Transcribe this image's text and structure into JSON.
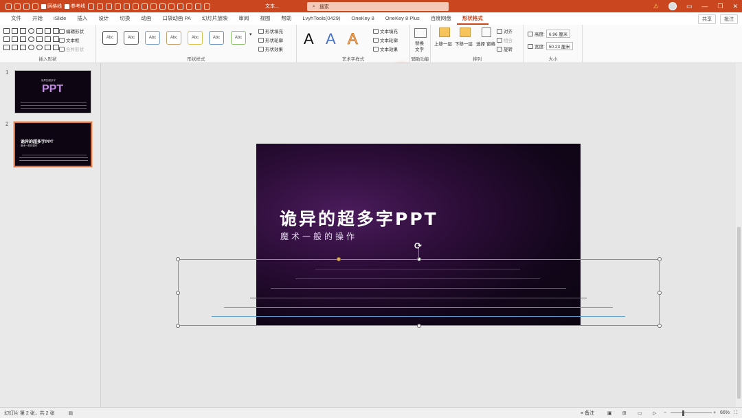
{
  "titlebar": {
    "gridlines_label": "网格线",
    "guides_label": "参考线",
    "doc_title": "文本...",
    "search_placeholder": "搜索",
    "warning_icon": "warning-icon"
  },
  "tabs": [
    "文件",
    "开始",
    "iSlide",
    "插入",
    "设计",
    "切换",
    "动画",
    "口袋动画 PA",
    "幻灯片放映",
    "审阅",
    "视图",
    "帮助",
    "LvyhTools(0429)",
    "OneKey 8",
    "OneKey 8 Plus",
    "百度网盘",
    "形状格式"
  ],
  "active_tab": "形状格式",
  "share_label": "共享",
  "comments_label": "批注",
  "ribbon": {
    "insert_shapes": {
      "label": "插入形状",
      "edit_shape": "编辑形状",
      "text_box": "文本框",
      "merge_shapes": "合并形状"
    },
    "shape_styles": {
      "label": "形状样式",
      "preset_text": "Abc",
      "fill": "形状填充",
      "outline": "形状轮廓",
      "effects": "形状效果"
    },
    "wordart_styles": {
      "label": "艺术字样式",
      "glyph": "A",
      "text_fill": "文本填充",
      "text_outline": "文本轮廓",
      "text_effects": "文本效果"
    },
    "accessibility": {
      "label": "辅助功能",
      "alt_text_line1": "替换",
      "alt_text_line2": "文字"
    },
    "arrange": {
      "label": "排列",
      "bring_forward": "上移一层",
      "send_backward": "下移一层",
      "selection_pane_line1": "选择",
      "selection_pane_line2": "窗格",
      "align": "对齐",
      "group": "组合",
      "rotate": "旋转"
    },
    "size": {
      "label": "大小",
      "height_label": "高度:",
      "height_value": "6.96 厘米",
      "width_label": "宽度:",
      "width_value": "50.23 厘米"
    }
  },
  "slides": [
    {
      "number": "1",
      "title": "PPT",
      "caption": "诡异的超多字"
    },
    {
      "number": "2",
      "title": "诡异的超多字PPT",
      "caption": "魔术一般的操作"
    }
  ],
  "slide": {
    "title": "诡异的超多字PPT",
    "subtitle": "魔术一般的操作"
  },
  "status": {
    "slide_info": "幻灯片 第 2 张，共 2 张",
    "notes": "备注",
    "zoom": "66%"
  }
}
